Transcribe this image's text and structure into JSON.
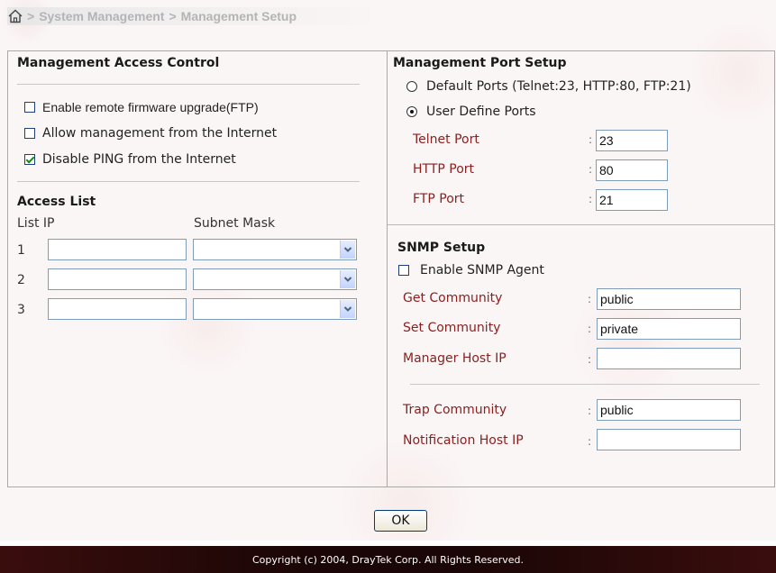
{
  "breadcrumb": {
    "home_icon": "home-icon",
    "separator": ">",
    "items": [
      "System Management",
      "Management Setup"
    ]
  },
  "access_control": {
    "title": "Management Access Control",
    "enable_ftp_upgrade": {
      "label": "Enable remote firmware upgrade(FTP)",
      "checked": false
    },
    "allow_internet_mgmt": {
      "label": "Allow management from the Internet",
      "checked": false
    },
    "disable_ping": {
      "label": "Disable PING from the Internet",
      "checked": true
    }
  },
  "access_list": {
    "title": "Access List",
    "col_ip": "List IP",
    "col_mask": "Subnet Mask",
    "rows": [
      {
        "num": "1",
        "ip": "",
        "mask": ""
      },
      {
        "num": "2",
        "ip": "",
        "mask": ""
      },
      {
        "num": "3",
        "ip": "",
        "mask": ""
      }
    ]
  },
  "port_setup": {
    "title": "Management Port Setup",
    "default_ports": {
      "label": "Default Ports (Telnet:23, HTTP:80, FTP:21)",
      "selected": false
    },
    "user_define": {
      "label": "User Define Ports",
      "selected": true
    },
    "telnet": {
      "label": "Telnet Port",
      "value": "23"
    },
    "http": {
      "label": "HTTP Port",
      "value": "80"
    },
    "ftp": {
      "label": "FTP Port",
      "value": "21"
    }
  },
  "snmp": {
    "title": "SNMP Setup",
    "enable_agent": {
      "label": "Enable SNMP Agent",
      "checked": false
    },
    "get_community": {
      "label": "Get Community",
      "value": "public"
    },
    "set_community": {
      "label": "Set Community",
      "value": "private"
    },
    "manager_host_ip": {
      "label": "Manager Host IP",
      "value": ""
    },
    "trap_community": {
      "label": "Trap Community",
      "value": "public"
    },
    "notification_host_ip": {
      "label": "Notification Host IP",
      "value": ""
    }
  },
  "colon": ":",
  "ok_label": "OK",
  "footer": "Copyright (c) 2004, DrayTek Corp. All Rights Reserved.",
  "colors": {
    "label_red": "#8a2020",
    "footer_bg": "#1a0606",
    "border": "#a9a9a9"
  }
}
